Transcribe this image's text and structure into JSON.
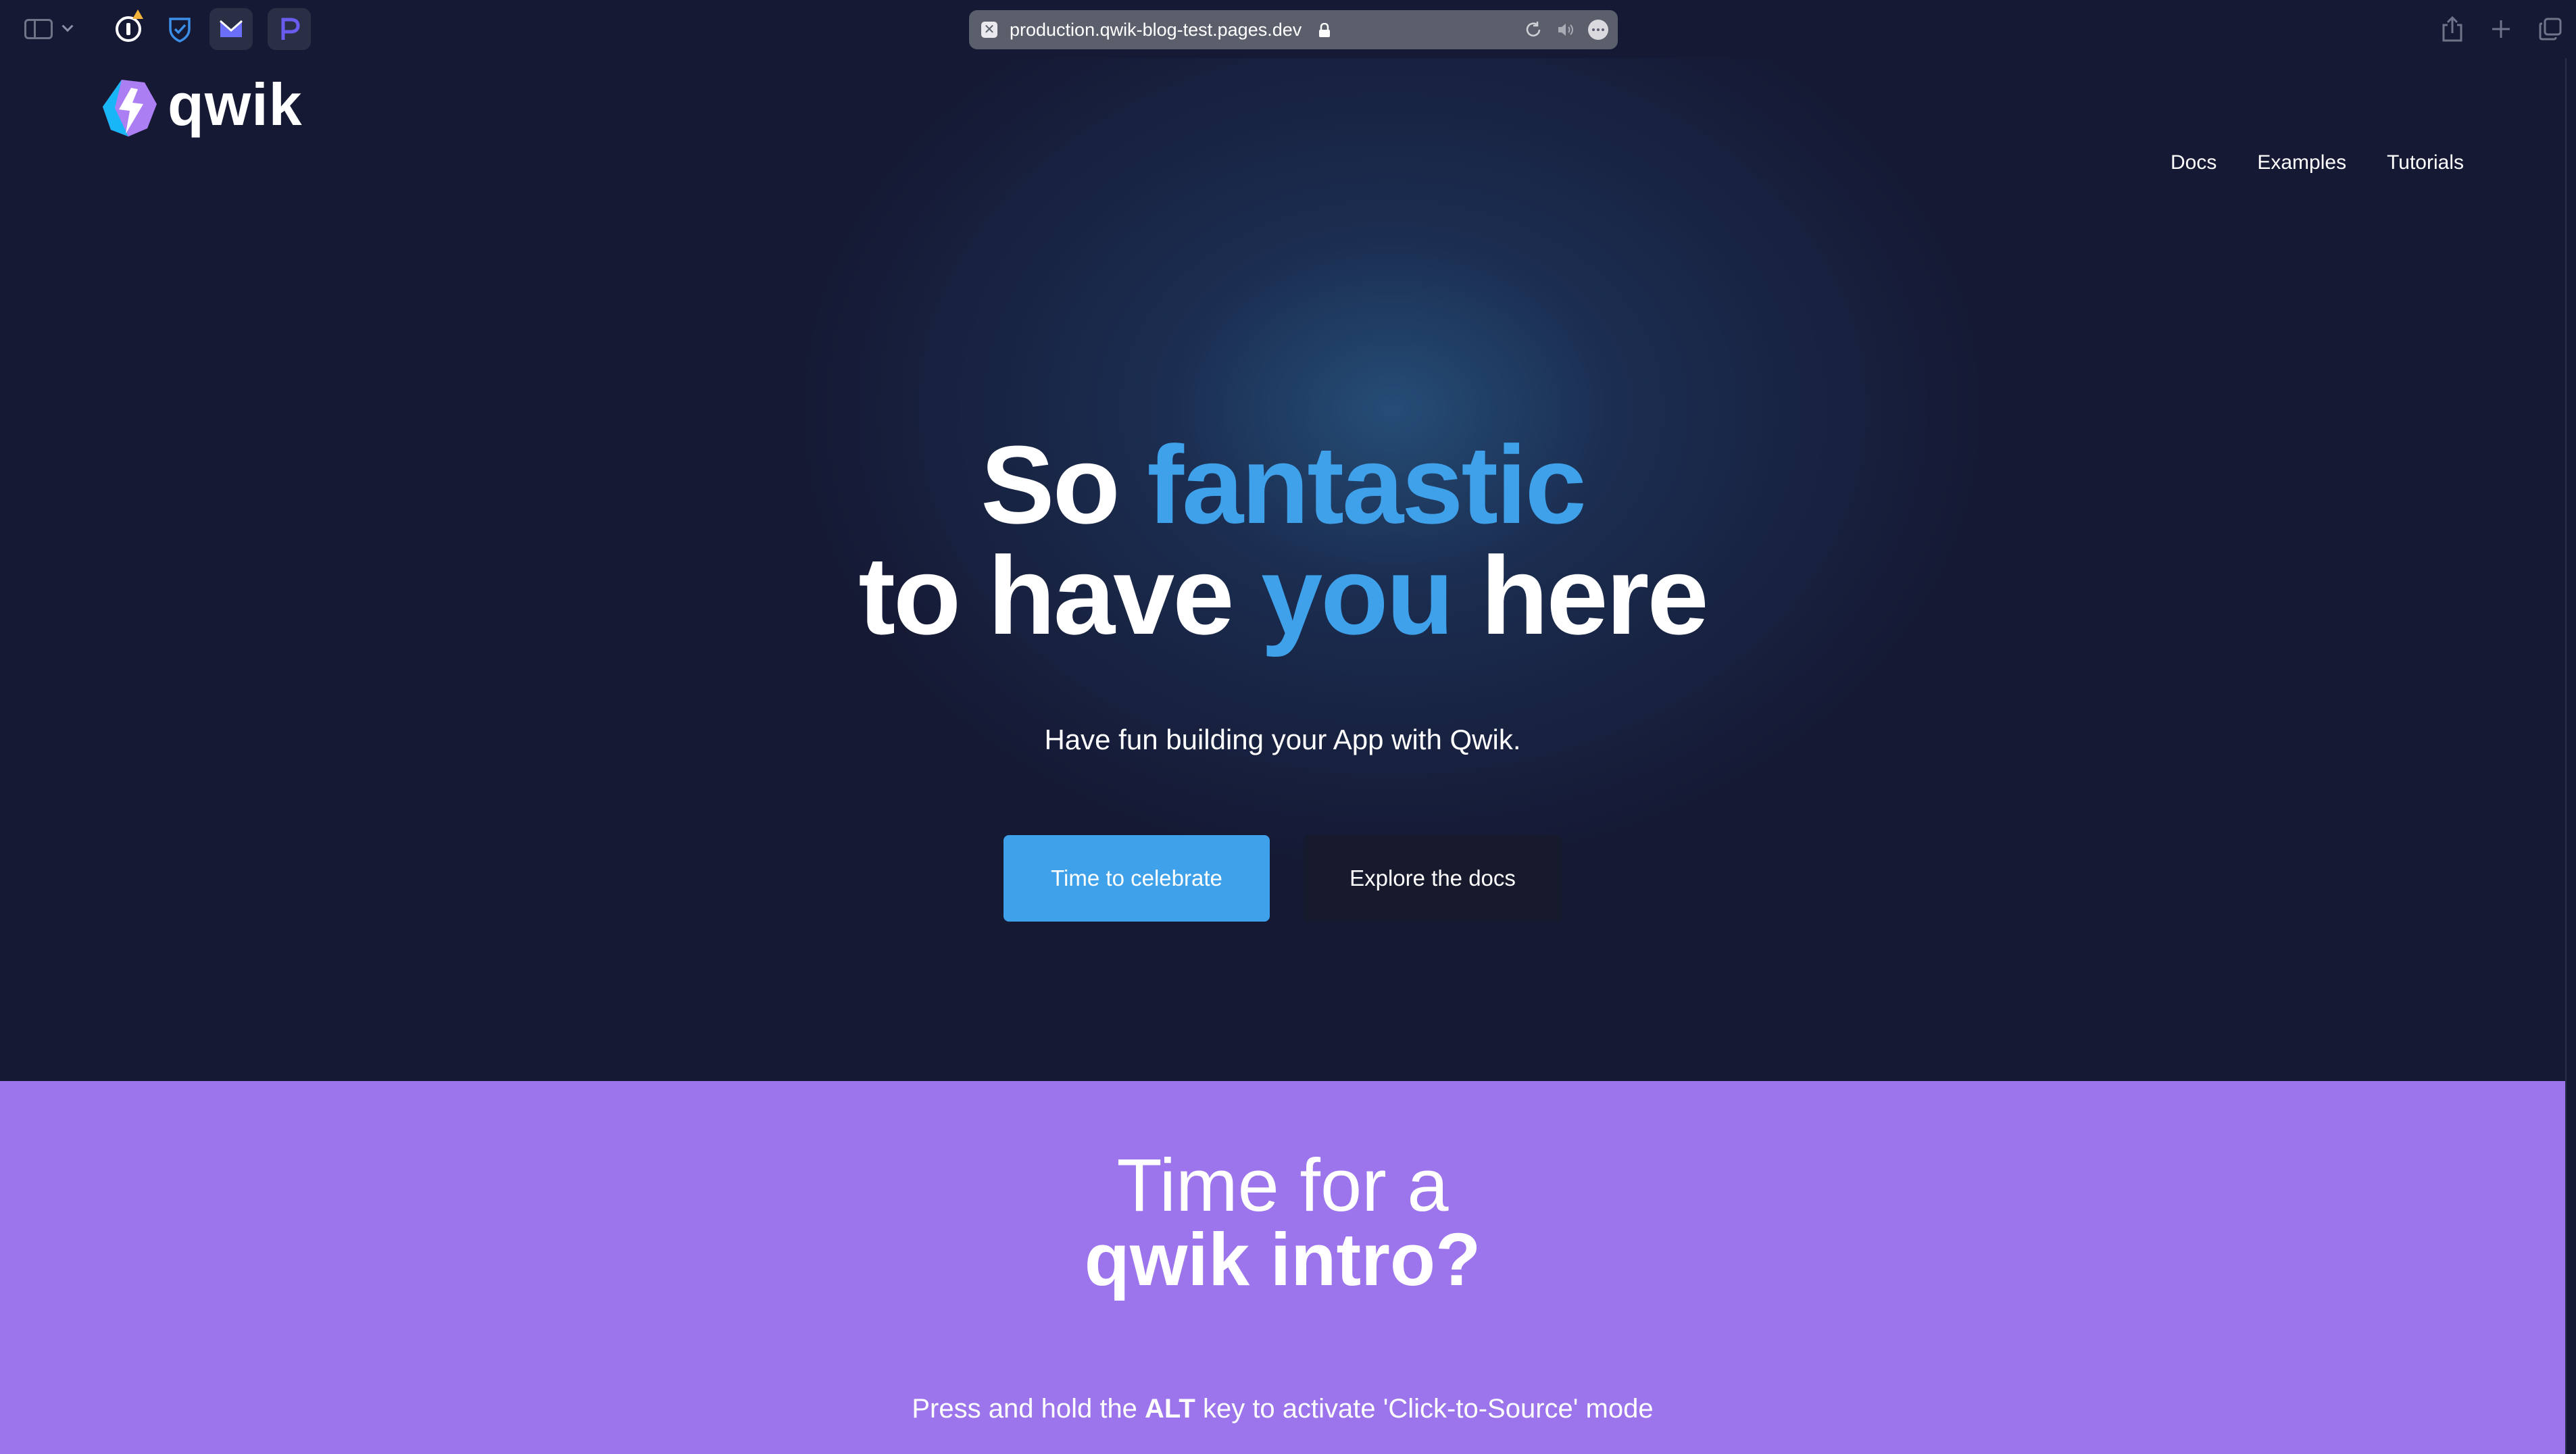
{
  "browser": {
    "url": "production.qwik-blog-test.pages.dev",
    "favicon_glyph": "✕",
    "extensions": [
      "1password-icon",
      "bitwarden-icon",
      "mailbrew-icon",
      "p-extension-icon"
    ]
  },
  "site": {
    "logo_text": "qwik",
    "nav": [
      {
        "label": "Docs"
      },
      {
        "label": "Examples"
      },
      {
        "label": "Tutorials"
      }
    ]
  },
  "hero": {
    "title_line1_a": "So ",
    "title_line1_accent": "fantastic",
    "title_line2_a": "to have ",
    "title_line2_accent": "you",
    "title_line2_b": " here",
    "subtitle": "Have fun building your App with Qwik.",
    "primary_button": "Time to celebrate",
    "secondary_button": "Explore the docs"
  },
  "intro": {
    "title_line1": "Time for a",
    "title_line2_bold": "qwik intro",
    "title_line2_end": "?",
    "hint_a": "Press and hold the ",
    "hint_key": "ALT",
    "hint_b": " key to activate 'Click-to-Source' mode"
  },
  "colors": {
    "background": "#151934",
    "accent": "#3fa1ea",
    "intro_background": "#9c74ec",
    "secondary_button": "#171a2c"
  }
}
